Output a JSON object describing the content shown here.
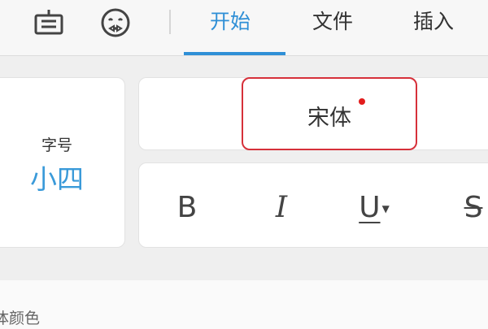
{
  "toolbar": {
    "icons": [
      "keyboard-icon",
      "emoji-face-icon"
    ],
    "tabs": [
      "开始",
      "文件",
      "插入"
    ],
    "active_tab": "开始"
  },
  "font_size": {
    "label": "字号",
    "value": "小四"
  },
  "font": {
    "name": "宋体"
  },
  "styles": {
    "bold": "B",
    "italic": "I",
    "underline": "U",
    "strikethrough": "S"
  },
  "lower_section": {
    "label": "体颜色"
  },
  "colors": {
    "accent": "#2f8fd6",
    "highlight_border": "#d6303a",
    "dot": "#e21c1c"
  }
}
